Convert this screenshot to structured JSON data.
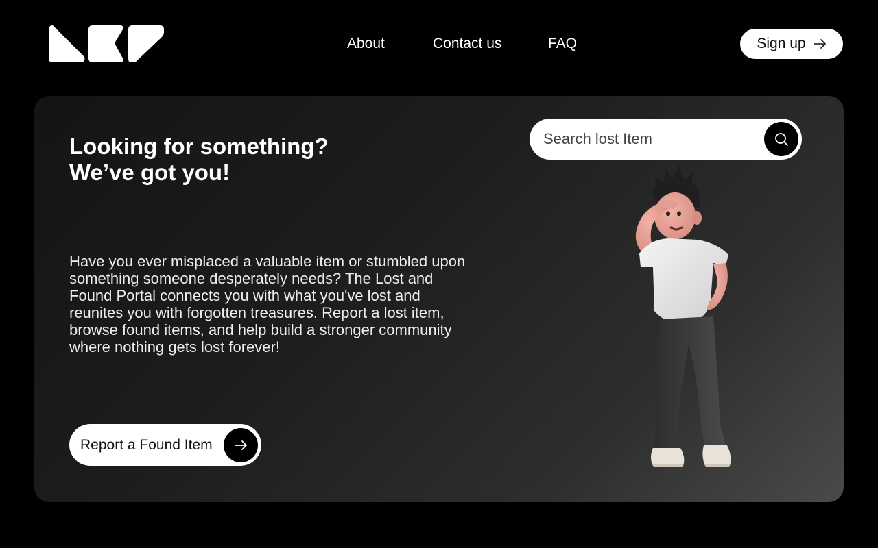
{
  "header": {
    "nav": {
      "about": "About",
      "contact": "Contact us",
      "faq": "FAQ"
    },
    "signup_label": "Sign up"
  },
  "hero": {
    "headline_line1": "Looking for something?",
    "headline_line2": "We’ve got you!",
    "description": "Have you ever misplaced a valuable item or stumbled upon something someone desperately needs? The Lost and Found Portal connects you with what you've lost and reunites you with forgotten treasures. Report a lost item, browse found items, and help build a stronger community where nothing gets lost forever!",
    "report_label": "Report a Found Item"
  },
  "search": {
    "placeholder": "Search lost Item"
  },
  "icons": {
    "signup": "arrow-right-icon",
    "report": "arrow-right-icon",
    "search": "magnifier-icon"
  },
  "colors": {
    "background": "#000000",
    "card_dark": "#141414",
    "card_light": "#4a4a4a",
    "button_bg": "#ffffff",
    "accent_dark": "#000000"
  }
}
